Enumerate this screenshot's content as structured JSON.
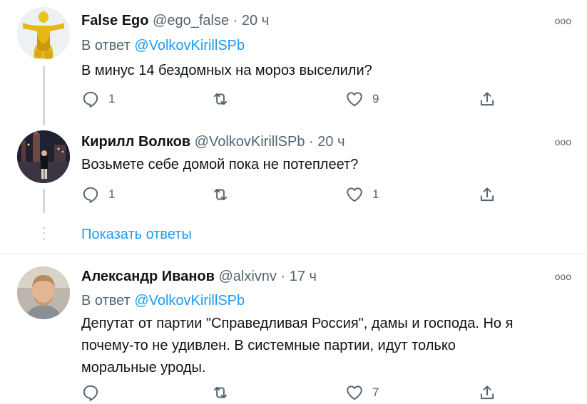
{
  "tweets": [
    {
      "name": "False Ego",
      "handle": "@ego_false",
      "dot": "·",
      "time": "20 ч",
      "reply_prefix": "В ответ ",
      "reply_to": "@VolkovKirillSPb",
      "text": "В минус 14 бездомных на мороз выселили?",
      "reply_count": "1",
      "retweet_count": "",
      "like_count": "9"
    },
    {
      "name": "Кирилл Волков",
      "handle": "@VolkovKirillSPb",
      "dot": "·",
      "time": "20 ч",
      "text": "Возьмете себе домой пока не потеплеет?",
      "reply_count": "1",
      "retweet_count": "",
      "like_count": "1"
    },
    {
      "name": "Александр Иванов",
      "handle": "@alxivnv",
      "dot": "·",
      "time": "17 ч",
      "reply_prefix": "В ответ ",
      "reply_to": "@VolkovKirillSPb",
      "text_lines": [
        "Депутат от партии \"Справедливая Россия\", дамы и господа. Но я",
        "почему-то не удивлен. В системные партии, идут только",
        "моральные уроды."
      ],
      "reply_count": "",
      "retweet_count": "",
      "like_count": "7"
    }
  ],
  "show_replies": "Показать ответы",
  "more_glyph": "ooo",
  "icons": {
    "reply": "reply-icon",
    "retweet": "retweet-icon",
    "like": "heart-icon",
    "share": "share-icon",
    "more": "more-icon"
  },
  "colors": {
    "link": "#1d9bf0",
    "secondary": "#536471",
    "primary_text": "#0f1419",
    "thread_line": "#cfd9de"
  }
}
